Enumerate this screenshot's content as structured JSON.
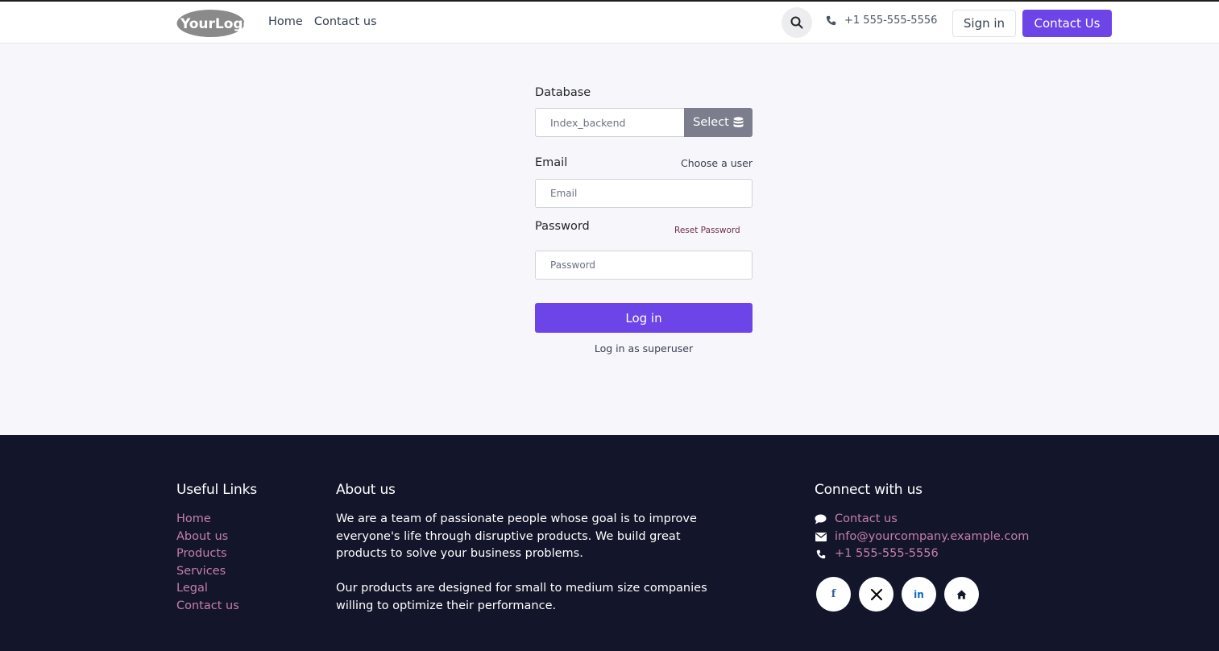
{
  "header": {
    "logo_text": "YourLogo",
    "nav": [
      {
        "label": "Home"
      },
      {
        "label": "Contact us"
      }
    ],
    "phone": "+1 555-555-5556",
    "signin_label": "Sign in",
    "contact_label": "Contact Us"
  },
  "login": {
    "database_label": "Database",
    "database_value": "Index_backend",
    "select_label": "Select",
    "email_label": "Email",
    "choose_user_label": "Choose a user",
    "email_placeholder": "Email",
    "password_label": "Password",
    "reset_password_label": "Reset Password",
    "password_placeholder": "Password",
    "login_label": "Log in",
    "superuser_label": "Log in as superuser"
  },
  "footer": {
    "useful_links_title": "Useful Links",
    "useful_links": [
      "Home",
      "About us",
      "Products",
      "Services",
      "Legal",
      "Contact us"
    ],
    "about_title": "About us",
    "about_p1": "We are a team of passionate people whose goal is to improve everyone's life through disruptive products. We build great products to solve your business problems.",
    "about_p2": "Our products are designed for small to medium size companies willing to optimize their performance.",
    "connect_title": "Connect with us",
    "connect_contact": "Contact us",
    "connect_email": "info@yourcompany.example.com",
    "connect_phone": "+1 555-555-5556",
    "socials": [
      {
        "name": "facebook-icon",
        "glyph": "f",
        "color": "#3b5998"
      },
      {
        "name": "x-icon",
        "glyph": "𝕏",
        "color": "#000000"
      },
      {
        "name": "linkedin-icon",
        "glyph": "in",
        "color": "#0a66c2"
      },
      {
        "name": "home-icon",
        "glyph": "⌂",
        "color": "#13152a"
      }
    ]
  },
  "colors": {
    "primary": "#6d44e8",
    "footer_bg": "#13152a",
    "footer_link": "#c47fab",
    "page_bg": "#f7f6fb"
  }
}
